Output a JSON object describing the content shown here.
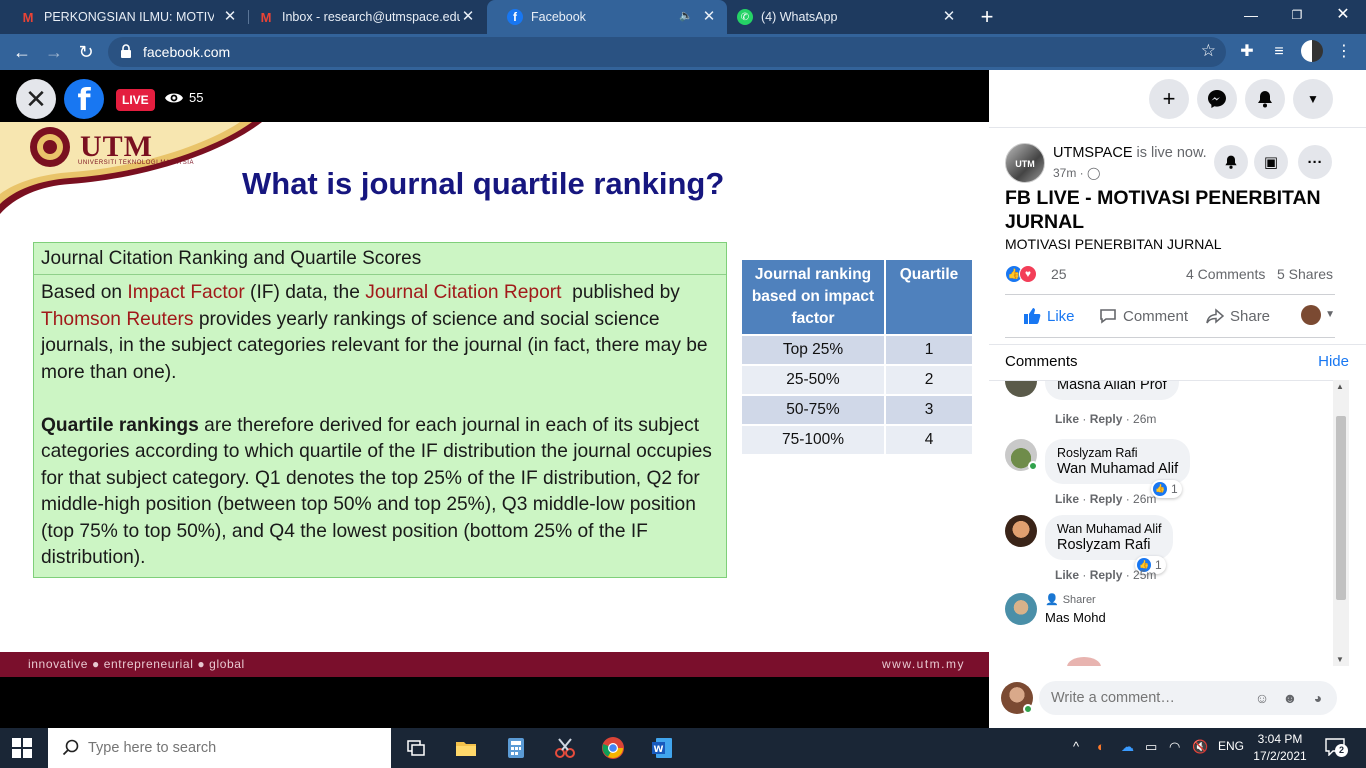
{
  "browser": {
    "tabs": [
      {
        "title": "PERKONGSIAN ILMU: MOTIVASI P",
        "icon": "gmail-icon"
      },
      {
        "title": "Inbox - research@utmspace.edu.",
        "icon": "gmail-icon"
      },
      {
        "title": "Facebook",
        "icon": "facebook-icon",
        "active": true
      },
      {
        "title": "(4) WhatsApp",
        "icon": "whatsapp-icon"
      }
    ],
    "new_tab": "+",
    "url": "facebook.com"
  },
  "video": {
    "live_label": "LIVE",
    "viewer_count": "55",
    "slide": {
      "logo_text": "UTM",
      "logo_sub": "UNIVERSITI TEKNOLOGI MALAYSIA",
      "title": "What is journal quartile ranking?",
      "box_heading": "Journal Citation Ranking and Quartile Scores",
      "para1": [
        {
          "t": "Based on "
        },
        {
          "t": "Impact Factor",
          "red": true
        },
        {
          "t": " (IF) data, the "
        },
        {
          "t": "Journal Citation Report",
          "red": true
        },
        {
          "t": "  published by  "
        },
        {
          "t": "Thomson Reuters",
          "red": true
        },
        {
          "t": "  provides yearly rankings of science and social science journals, in the subject categories relevant for the journal (in fact, there may be more than one)."
        }
      ],
      "para2_bold": "Quartile rankings",
      "para2": " are therefore derived for each journal in each of its subject categories according to which quartile of the IF distribution the journal occupies for that subject category. Q1 denotes the top 25% of the IF distribution, Q2 for middle-high position (between top 50% and top 25%), Q3 middle-low position (top 75% to top 50%), and Q4 the lowest position (bottom 25% of the IF distribution).",
      "table": {
        "headers": [
          "Journal ranking based on impact factor",
          "Quartile"
        ],
        "rows": [
          [
            "Top 25%",
            "1"
          ],
          [
            "25-50%",
            "2"
          ],
          [
            "50-75%",
            "3"
          ],
          [
            "75-100%",
            "4"
          ]
        ]
      },
      "footer_left": "innovative ● entrepreneurial ● global",
      "footer_right": "www.utm.my"
    }
  },
  "post": {
    "author": "UTMSPACE",
    "status": " is live now.",
    "time": "37m ·",
    "title": "FB LIVE - MOTIVASI PENERBITAN JURNAL",
    "subtitle": "MOTIVASI PENERBITAN JURNAL",
    "reaction_count": "25",
    "comments_count": "4 Comments",
    "shares_count": "5 Shares",
    "actions": {
      "like": "Like",
      "comment": "Comment",
      "share": "Share"
    }
  },
  "comments_panel": {
    "heading": "Comments",
    "hide": "Hide",
    "comments": [
      {
        "author": "",
        "text": "Masha Allah Prof",
        "like": "Like",
        "reply": "Reply",
        "time": "26m"
      },
      {
        "author": "Roslyzam Rafi",
        "text": "Wan Muhamad Alif",
        "like": "Like",
        "reply": "Reply",
        "time": "26m",
        "reactions": "1"
      },
      {
        "author": "Wan Muhamad Alif",
        "text": "Roslyzam Rafi",
        "like": "Like",
        "reply": "Reply",
        "time": "25m",
        "reactions": "1"
      },
      {
        "author": "Mas Mohd",
        "sharer_label": "Sharer"
      }
    ],
    "input_placeholder": "Write a comment…"
  },
  "taskbar": {
    "search_placeholder": "Type here to search",
    "lang": "ENG",
    "time": "3:04 PM",
    "date": "17/2/2021",
    "notifications": "2"
  }
}
